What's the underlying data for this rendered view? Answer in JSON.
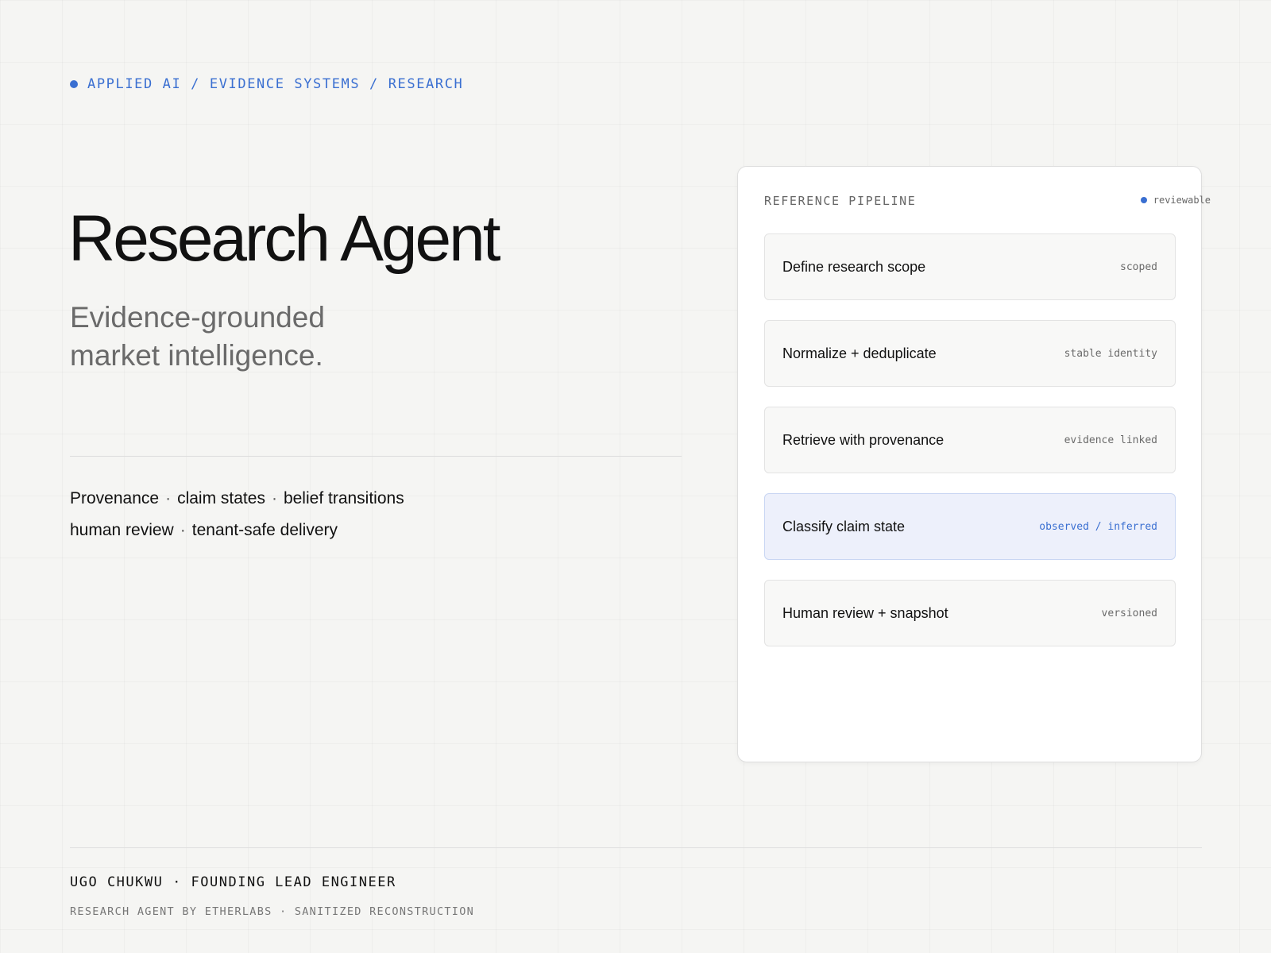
{
  "breadcrumb": "APPLIED AI / EVIDENCE SYSTEMS / RESEARCH",
  "title": "Research Agent",
  "subtitle": {
    "line1": "Evidence-grounded",
    "line2": "market intelligence."
  },
  "tags": {
    "line1": [
      "Provenance",
      "claim states",
      "belief transitions"
    ],
    "line2": [
      "human review",
      "tenant-safe delivery"
    ],
    "separator": "·"
  },
  "pipeline": {
    "heading": "REFERENCE PIPELINE",
    "status": "reviewable",
    "steps": [
      {
        "label": "Define research scope",
        "state": "scoped",
        "active": false
      },
      {
        "label": "Normalize + deduplicate",
        "state": "stable identity",
        "active": false
      },
      {
        "label": "Retrieve with provenance",
        "state": "evidence linked",
        "active": false
      },
      {
        "label": "Classify claim state",
        "state": "observed / inferred",
        "active": true
      },
      {
        "label": "Human review + snapshot",
        "state": "versioned",
        "active": false
      }
    ]
  },
  "footer": {
    "author": "UGO CHUKWU · FOUNDING LEAD ENGINEER",
    "credit": "RESEARCH AGENT BY ETHERLABS · SANITIZED RECONSTRUCTION"
  },
  "colors": {
    "accent": "#3a6fd1",
    "background": "#f5f5f3",
    "active_step_bg": "#edf0fb"
  }
}
